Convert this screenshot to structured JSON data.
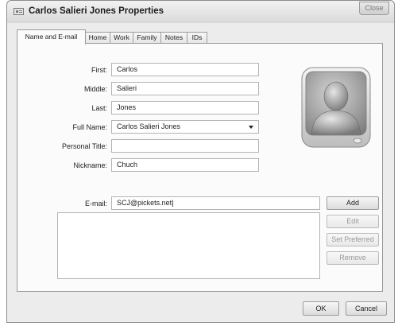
{
  "window": {
    "title": "Carlos Salieri Jones Properties",
    "close_label": "Close"
  },
  "tabs": [
    {
      "label": "Name and E-mail",
      "active": true
    },
    {
      "label": "Home",
      "active": false
    },
    {
      "label": "Work",
      "active": false
    },
    {
      "label": "Family",
      "active": false
    },
    {
      "label": "Notes",
      "active": false
    },
    {
      "label": "IDs",
      "active": false
    }
  ],
  "form": {
    "first_label": "First:",
    "first_value": "Carlos",
    "middle_label": "Middle:",
    "middle_value": "Salieri",
    "last_label": "Last:",
    "last_value": "Jones",
    "full_name_label": "Full Name:",
    "full_name_value": "Carlos Salieri Jones",
    "personal_title_label": "Personal Title:",
    "personal_title_value": "",
    "nickname_label": "Nickname:",
    "nickname_value": "Chuch",
    "email_label": "E-mail:",
    "email_value": "SCJ@pickets.net"
  },
  "email_buttons": {
    "add": "Add",
    "edit": "Edit",
    "set_preferred": "Set Preferred",
    "remove": "Remove"
  },
  "footer": {
    "ok": "OK",
    "cancel": "Cancel"
  },
  "colors": {
    "dialog_bg": "#ececec",
    "panel_bg": "#fbfbfb",
    "disabled_text": "#9a9a9a"
  },
  "icons": {
    "contact_photo": "generic-person-silhouette"
  }
}
